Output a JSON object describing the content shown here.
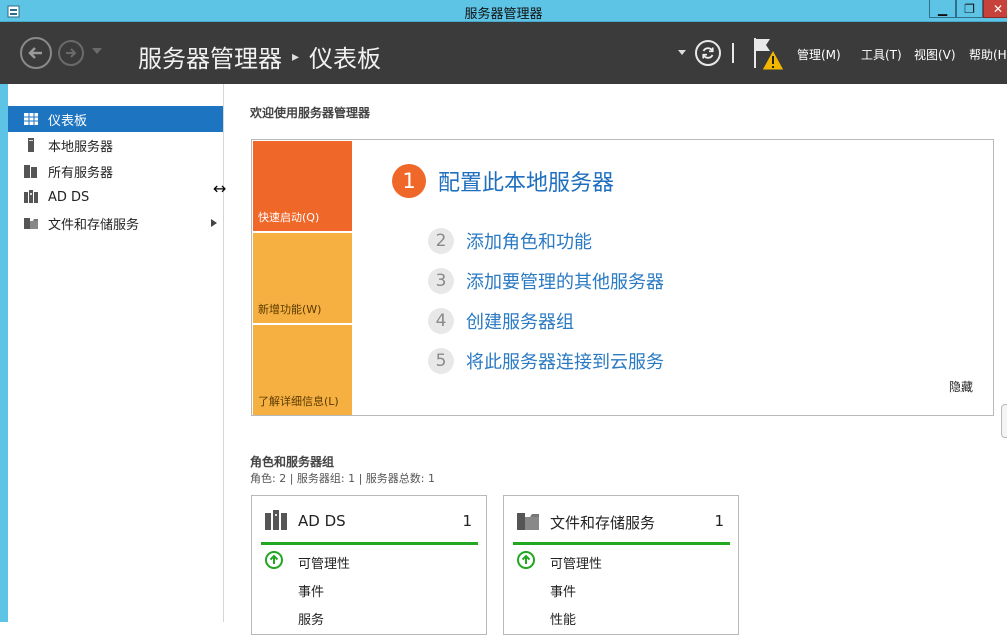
{
  "window": {
    "title": "服务器管理器",
    "min": "▁",
    "max": "❐",
    "close": "✕"
  },
  "header": {
    "breadcrumb_app": "服务器管理器",
    "breadcrumb_sep": "▸",
    "breadcrumb_page": "仪表板",
    "menus": [
      "管理(M)",
      "工具(T)",
      "视图(V)",
      "帮助(H)"
    ]
  },
  "sidebar": {
    "items": [
      {
        "label": "仪表板",
        "icon": "dashboard-icon"
      },
      {
        "label": "本地服务器",
        "icon": "server-icon"
      },
      {
        "label": "所有服务器",
        "icon": "servers-icon"
      },
      {
        "label": "AD DS",
        "icon": "ad-ds-icon"
      },
      {
        "label": "文件和存储服务",
        "icon": "file-storage-icon"
      }
    ]
  },
  "welcome": {
    "title": "欢迎使用服务器管理器",
    "tiles": [
      "快速启动(Q)",
      "新增功能(W)",
      "了解详细信息(L)"
    ],
    "main_step": {
      "num": "1",
      "label": "配置此本地服务器"
    },
    "steps": [
      {
        "num": "2",
        "label": "添加角色和功能"
      },
      {
        "num": "3",
        "label": "添加要管理的其他服务器"
      },
      {
        "num": "4",
        "label": "创建服务器组"
      },
      {
        "num": "5",
        "label": "将此服务器连接到云服务"
      }
    ],
    "hide": "隐藏"
  },
  "roles": {
    "title": "角色和服务器组",
    "summary": "角色: 2 | 服务器组: 1 | 服务器总数: 1",
    "cards": [
      {
        "name": "AD DS",
        "count": "1",
        "rows": [
          "可管理性",
          "事件",
          "服务"
        ]
      },
      {
        "name": "文件和存储服务",
        "count": "1",
        "rows": [
          "可管理性",
          "事件",
          "性能"
        ]
      }
    ]
  },
  "colors": {
    "accent": "#1d75c2",
    "tile_primary": "#f0672a",
    "tile_secondary": "#f6b041",
    "status_ok": "#22a722"
  }
}
